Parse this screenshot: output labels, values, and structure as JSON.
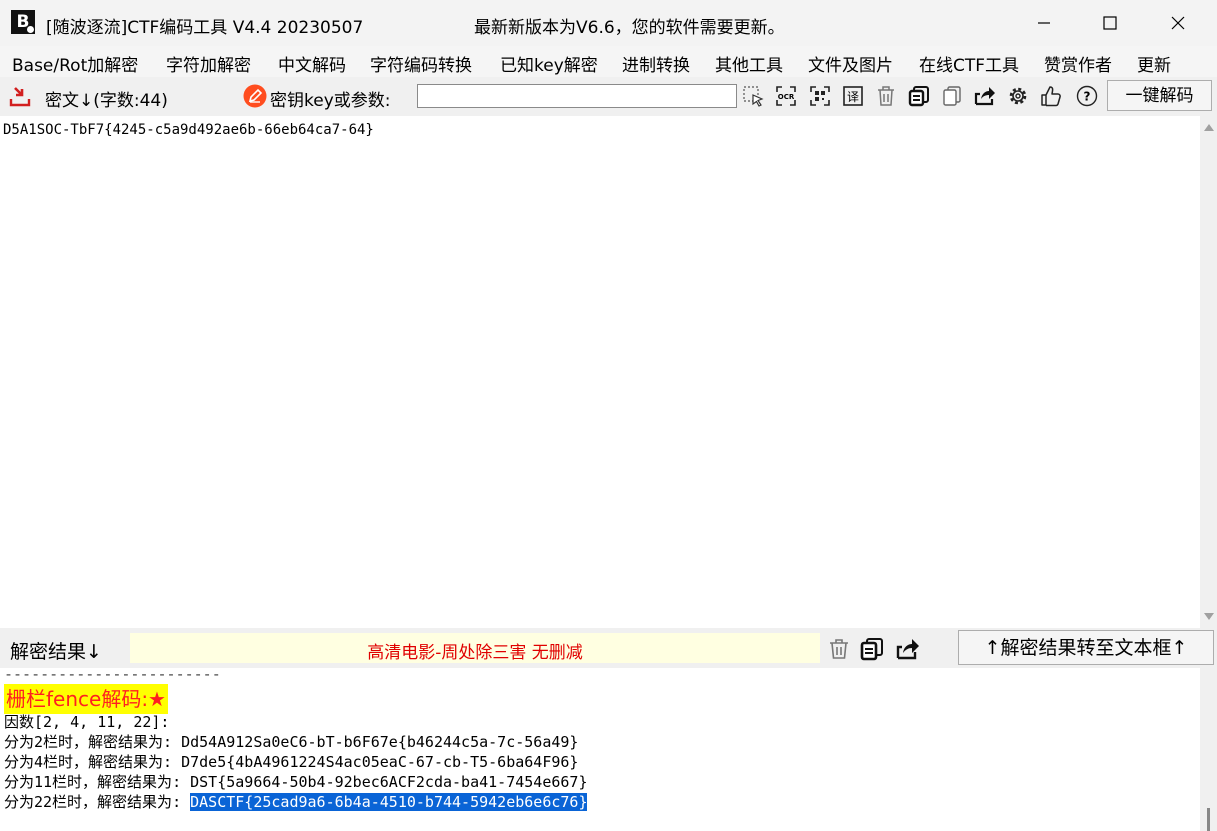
{
  "window": {
    "title": "[随波逐流]CTF编码工具 V4.4 20230507",
    "update_notice": "最新新版本为V6.6，您的软件需要更新。",
    "logo_text": "B"
  },
  "menu": [
    "Base/Rot加解密",
    "字符加解密",
    "中文解码",
    "字符编码转换",
    "已知key解密",
    "进制转换",
    "其他工具",
    "文件及图片",
    "在线CTF工具",
    "赞赏作者",
    "更新"
  ],
  "toolbar": {
    "cipher_label": "密文↓(字数:44)",
    "key_label": "密钥key或参数:",
    "key_value": "",
    "onekey_label": "一键解码"
  },
  "input": {
    "text": "D5A1SOC-TbF7{4245-c5a9d492ae6b-66eb64ca7-64}"
  },
  "result_bar": {
    "label": "解密结果↓",
    "ad_text": "高清电影-周处除三害 无删减",
    "transfer_label": "↑解密结果转至文本框↑"
  },
  "output": {
    "divider": "------------------------",
    "fence_title": "栅栏fence解码:★",
    "factors": "因数[2, 4, 11, 22]:",
    "lines": [
      "分为2栏时，解密结果为: Dd54A912Sa0eC6-bT-b6F67e{b46244c5a-7c-56a49}",
      "分为4栏时，解密结果为: D7de5{4bA4961224S4ac05eaC-67-cb-T5-6ba64F96}",
      "分为11栏时，解密结果为: DST{5a9664-50b4-92bec6ACF2cda-ba41-7454e667}"
    ],
    "last_prefix": "分为22栏时，解密结果为: ",
    "last_selected": "DASCTF{25cad9a6-6b4a-4510-b744-5942eb6e6c76}"
  },
  "colors": {
    "ad_text": "#e00000",
    "fence_title_bg": "#ffff00",
    "fence_title_text": "#ff2020",
    "selection": "#0a64d6"
  }
}
